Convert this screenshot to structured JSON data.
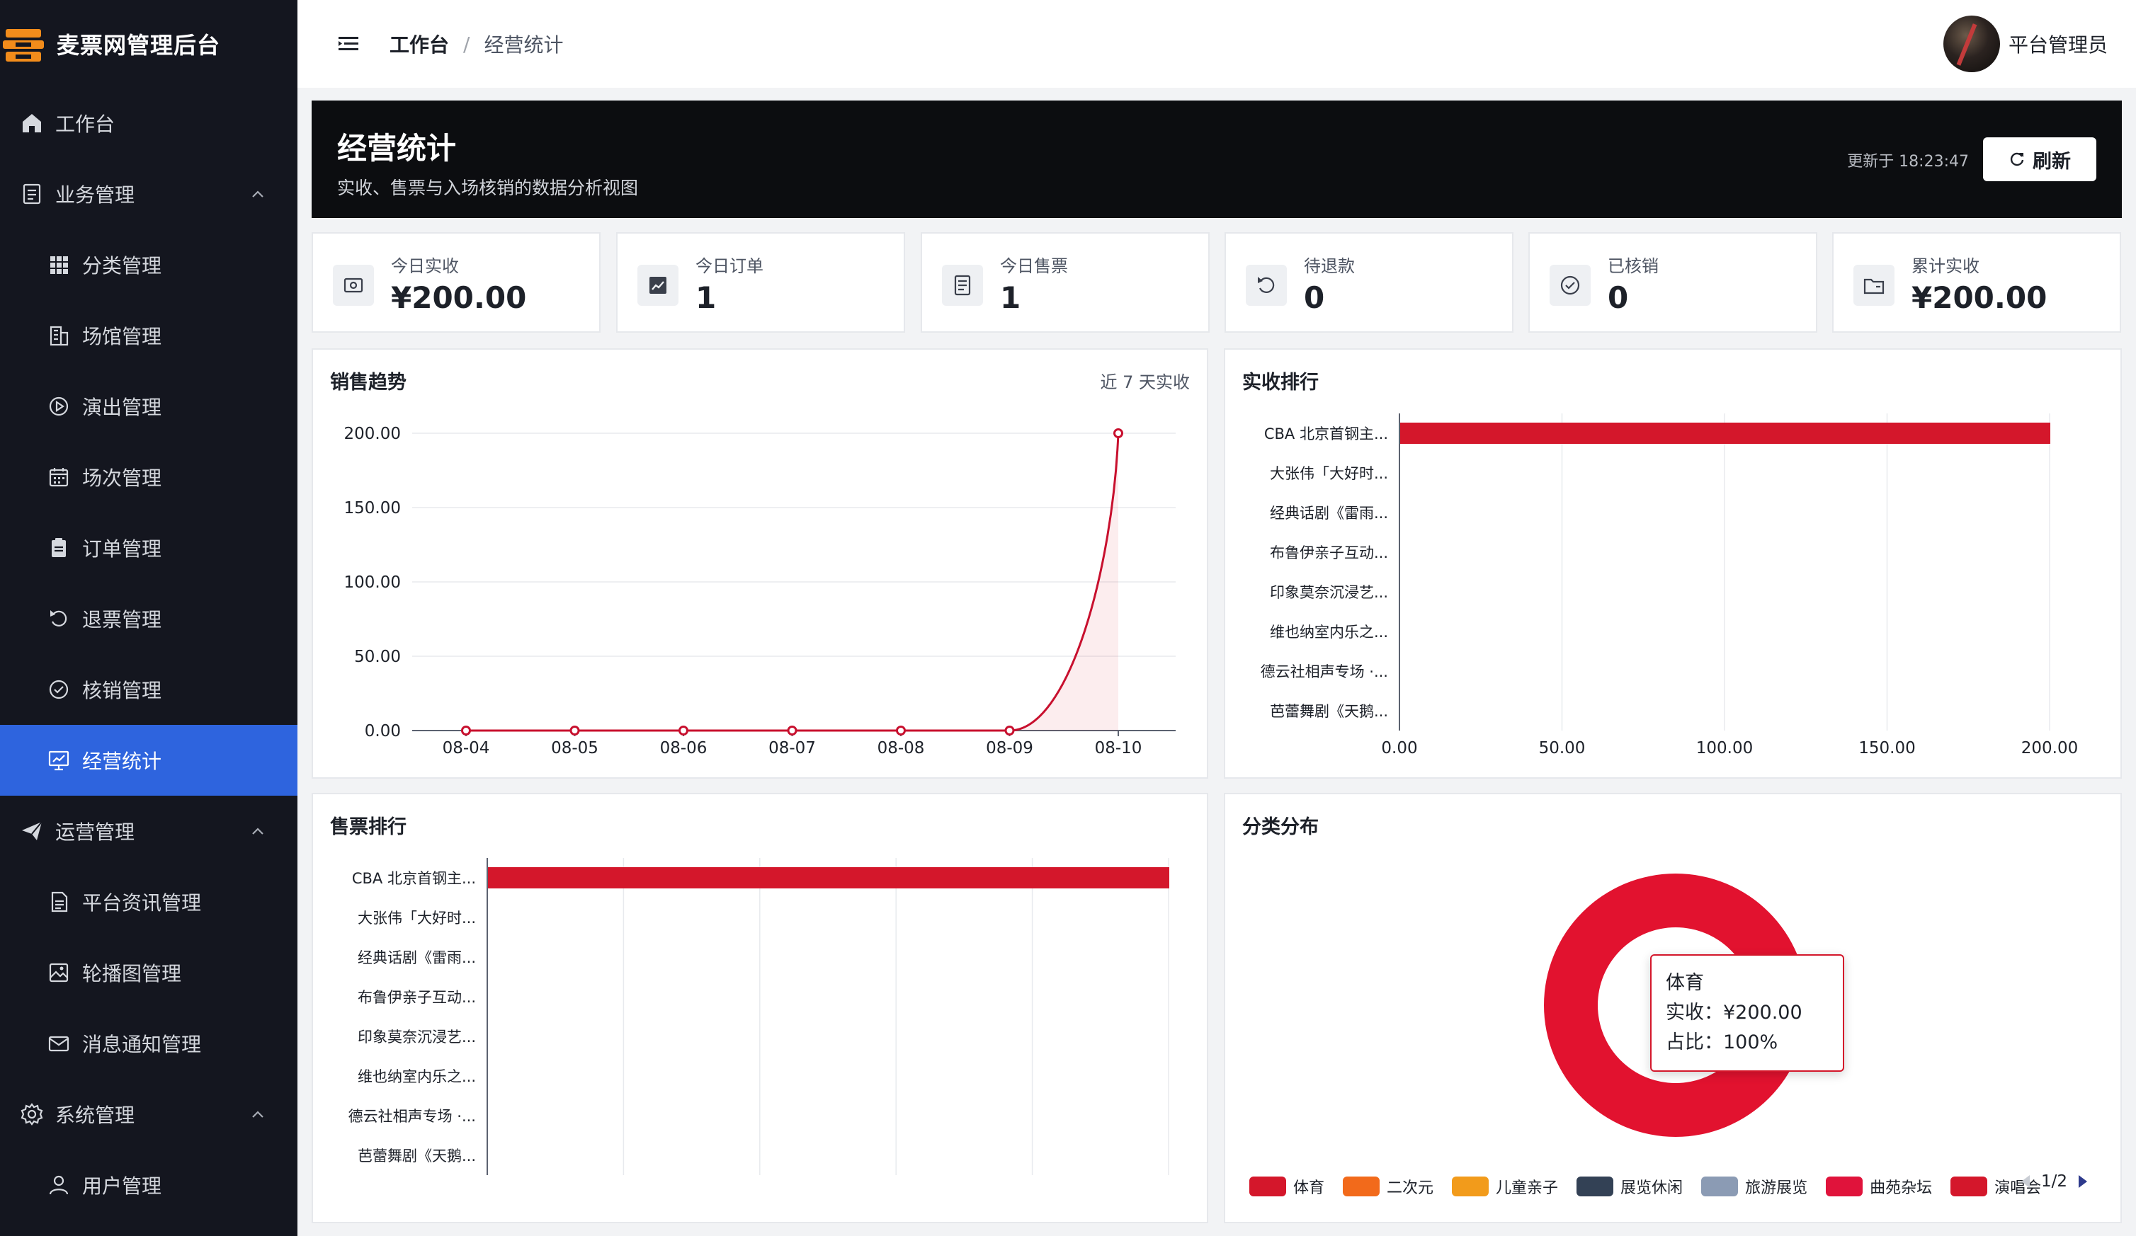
{
  "app": {
    "title": "麦票网管理后台"
  },
  "colors": {
    "sidebar_bg": "#14161f",
    "active": "#2e64de",
    "accent_red": "#d4172b"
  },
  "sidebar": {
    "items": [
      {
        "label": "工作台",
        "icon": "home-icon",
        "level": "top"
      },
      {
        "label": "业务管理",
        "icon": "document-icon",
        "level": "top",
        "expanded": true
      },
      {
        "label": "分类管理",
        "icon": "grid-icon",
        "level": "sub"
      },
      {
        "label": "场馆管理",
        "icon": "building-icon",
        "level": "sub"
      },
      {
        "label": "演出管理",
        "icon": "play-circle-icon",
        "level": "sub"
      },
      {
        "label": "场次管理",
        "icon": "calendar-icon",
        "level": "sub"
      },
      {
        "label": "订单管理",
        "icon": "clipboard-icon",
        "level": "sub"
      },
      {
        "label": "退票管理",
        "icon": "undo-icon",
        "level": "sub"
      },
      {
        "label": "核销管理",
        "icon": "check-circle-icon",
        "level": "sub"
      },
      {
        "label": "经营统计",
        "icon": "chart-board-icon",
        "level": "sub",
        "active": true
      },
      {
        "label": "运营管理",
        "icon": "send-icon",
        "level": "top",
        "expanded": true
      },
      {
        "label": "平台资讯管理",
        "icon": "news-icon",
        "level": "sub"
      },
      {
        "label": "轮播图管理",
        "icon": "image-icon",
        "level": "sub"
      },
      {
        "label": "消息通知管理",
        "icon": "mail-icon",
        "level": "sub"
      },
      {
        "label": "系统管理",
        "icon": "gear-icon",
        "level": "top",
        "expanded": true
      },
      {
        "label": "用户管理",
        "icon": "user-icon",
        "level": "sub"
      }
    ]
  },
  "header": {
    "breadcrumb": [
      "工作台",
      "经营统计"
    ],
    "breadcrumb_sep": "/",
    "user_name": "平台管理员"
  },
  "banner": {
    "title": "经营统计",
    "subtitle": "实收、售票与入场核销的数据分析视图",
    "updated": "更新于 18:23:47",
    "refresh_label": "刷新"
  },
  "stats": [
    {
      "label": "今日实收",
      "value": "¥200.00",
      "icon": "wallet-icon"
    },
    {
      "label": "今日订单",
      "value": "1",
      "icon": "trend-chart-icon"
    },
    {
      "label": "今日售票",
      "value": "1",
      "icon": "ticket-list-icon"
    },
    {
      "label": "待退款",
      "value": "0",
      "icon": "undo-icon"
    },
    {
      "label": "已核销",
      "value": "0",
      "icon": "check-circle-icon"
    },
    {
      "label": "累计实收",
      "value": "¥200.00",
      "icon": "folder-icon"
    }
  ],
  "panels": {
    "trend_title": "销售趋势",
    "trend_note": "近 7 天实收",
    "revenue_rank_title": "实收排行",
    "ticket_rank_title": "售票排行",
    "category_title": "分类分布"
  },
  "chart_data": [
    {
      "type": "line",
      "title": "销售趋势",
      "x": [
        "08-04",
        "08-05",
        "08-06",
        "08-07",
        "08-08",
        "08-09",
        "08-10"
      ],
      "values": [
        0,
        0,
        0,
        0,
        0,
        0,
        200
      ],
      "yticks": [
        "0.00",
        "50.00",
        "100.00",
        "150.00",
        "200.00"
      ],
      "ylim": [
        0,
        200
      ],
      "grid": true,
      "color": "#c8102e"
    },
    {
      "type": "bar",
      "orientation": "horizontal",
      "title": "实收排行",
      "categories": [
        "CBA 北京首钢主...",
        "大张伟「大好时...",
        "经典话剧《雷雨...",
        "布鲁伊亲子互动...",
        "印象莫奈沉浸艺...",
        "维也纳室内乐之...",
        "德云社相声专场 ·...",
        "芭蕾舞剧《天鹅..."
      ],
      "values": [
        200,
        0,
        0,
        0,
        0,
        0,
        0,
        0
      ],
      "xticks": [
        "0.00",
        "50.00",
        "100.00",
        "150.00",
        "200.00"
      ],
      "xlim": [
        0,
        200
      ],
      "grid": true,
      "color": "#d4172b"
    },
    {
      "type": "bar",
      "orientation": "horizontal",
      "title": "售票排行",
      "categories": [
        "CBA 北京首钢主...",
        "大张伟「大好时...",
        "经典话剧《雷雨...",
        "布鲁伊亲子互动...",
        "印象莫奈沉浸艺...",
        "维也纳室内乐之...",
        "德云社相声专场 ·...",
        "芭蕾舞剧《天鹅..."
      ],
      "values": [
        1,
        0,
        0,
        0,
        0,
        0,
        0,
        0
      ],
      "xlim": [
        0,
        1
      ],
      "grid": true,
      "color": "#d4172b"
    },
    {
      "type": "pie",
      "variant": "donut",
      "title": "分类分布",
      "slices": [
        {
          "name": "体育",
          "value": 200,
          "percent": "100%"
        }
      ],
      "tooltip": {
        "name": "体育",
        "revenue_label": "实收：",
        "revenue": "¥200.00",
        "percent_label": "占比：",
        "percent": "100%"
      },
      "legend": [
        {
          "name": "体育",
          "color": "#d4172b"
        },
        {
          "name": "二次元",
          "color": "#f26a1b"
        },
        {
          "name": "儿童亲子",
          "color": "#f29b1b"
        },
        {
          "name": "展览休闲",
          "color": "#334155"
        },
        {
          "name": "旅游展览",
          "color": "#8b9bb4"
        },
        {
          "name": "曲苑杂坛",
          "color": "#e0133b"
        },
        {
          "name": "演唱会",
          "color": "#d4172b"
        }
      ],
      "legend_page": "1/2",
      "legend_placement": "bottom"
    }
  ]
}
